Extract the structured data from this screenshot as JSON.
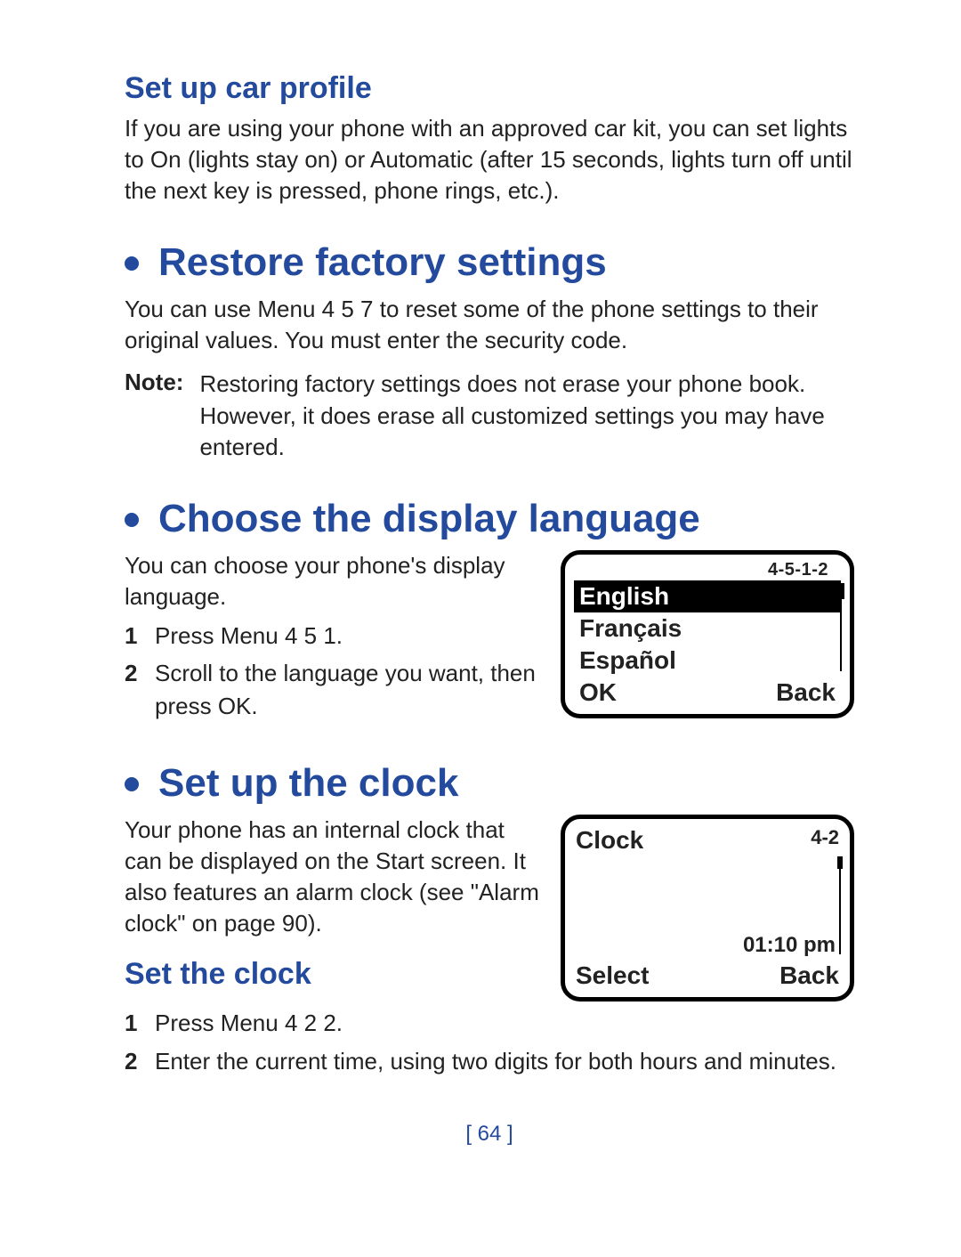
{
  "sec_car": {
    "title": "Set up car profile",
    "body_a": "If you are using your phone with an approved car kit, you can set lights to ",
    "opt_on": "On",
    "body_b": " (lights stay on) or ",
    "opt_auto": "Automatic",
    "body_c": " (after 15 seconds, lights turn off until the next key is pressed, phone rings, etc.)."
  },
  "sec_restore": {
    "title": "Restore factory settings",
    "body_a": "You can use ",
    "menu_word": "Menu",
    "menu_code": " 4 5 7",
    "body_b": " to reset some of the phone settings to their original values. You must enter the security code.",
    "note_label": "Note:",
    "note_body": "Restoring factory settings does not erase your phone book. However, it does erase all customized settings you may have entered."
  },
  "sec_lang": {
    "title": "Choose the display language",
    "body": "You can choose your phone's display language.",
    "step1_a": "Press ",
    "step1_menu": "Menu",
    "step1_code": " 4 5 1.",
    "step2_a": "Scroll to the language you want, then press ",
    "step2_ok": "OK",
    "screen": {
      "code": "4-5-1-2",
      "items": [
        "English",
        "Français",
        "Español"
      ],
      "left": "OK",
      "right": "Back"
    }
  },
  "sec_clock": {
    "title": "Set up the clock",
    "body": "Your phone has an internal clock that can be displayed on the Start screen. It also features an alarm clock (see \"Alarm clock\" on page 90).",
    "sub_title": "Set the clock",
    "step1_a": "Press ",
    "step1_menu": "Menu",
    "step1_code": " 4 2 2.",
    "step2": "Enter the current time, using two digits for both hours and minutes.",
    "screen": {
      "title": "Clock",
      "code": "4-2",
      "time": "01:10 pm",
      "left": "Select",
      "right": "Back"
    }
  },
  "page_number": "[ 64 ]"
}
